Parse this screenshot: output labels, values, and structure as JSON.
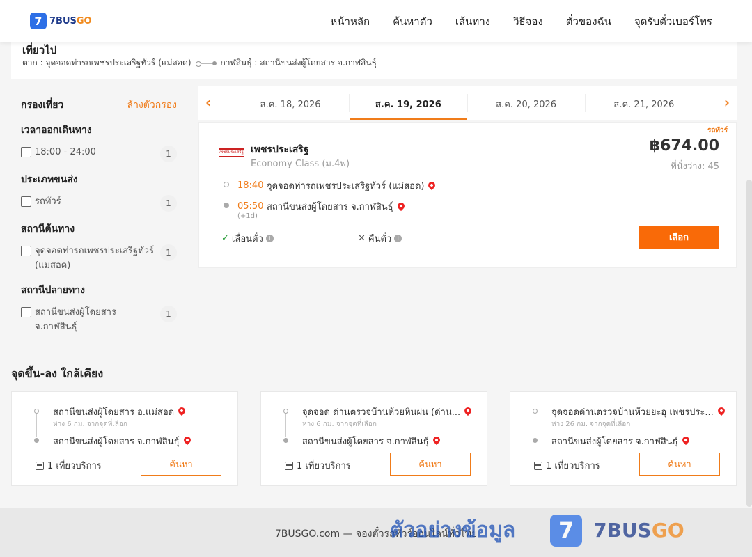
{
  "brand": {
    "logo_mark": "7",
    "name_a": "7BUS",
    "name_b": "GO"
  },
  "nav": [
    "หน้าหลัก",
    "ค้นหาตั๋ว",
    "เส้นทาง",
    "วิธีจอง",
    "ตั๋วของฉัน",
    "จุดรับตั๋วเบอร์โทร"
  ],
  "trip": {
    "title": "เที่ยวไป",
    "from": "ตาก : จุดจอดท่ารถเพชรประเสริฐทัวร์ (แม่สอด)",
    "to": "กาฬสินธุ์ : สถานีขนส่งผู้โดยสาร จ.กาฬสินธุ์"
  },
  "filters": {
    "title": "กรองเที่ยว",
    "clear": "ล้างตัวกรอง",
    "sections": [
      {
        "title": "เวลาออกเดินทาง",
        "options": [
          {
            "label": "18:00 - 24:00",
            "count": "1"
          }
        ]
      },
      {
        "title": "ประเภทขนส่ง",
        "options": [
          {
            "label": "รถทัวร์",
            "count": "1"
          }
        ]
      },
      {
        "title": "สถานีต้นทาง",
        "options": [
          {
            "label": "จุดจอดท่ารถเพชรประเสริฐทัวร์ (แม่สอด)",
            "count": "1"
          }
        ]
      },
      {
        "title": "สถานีปลายทาง",
        "options": [
          {
            "label": "สถานีขนส่งผู้โดยสาร จ.กาฬสินธุ์",
            "count": "1"
          }
        ]
      }
    ]
  },
  "dates": {
    "prev_icon": "‹",
    "next_icon": "›",
    "tabs": [
      "ส.ค. 18, 2026",
      "ส.ค. 19, 2026",
      "ส.ค. 20, 2026",
      "ส.ค. 21, 2026"
    ],
    "active_index": 1
  },
  "result": {
    "vehicle_type": "รถทัวร์",
    "operator_logo_text": "เพชรประเสริฐ",
    "operator": "เพชรประเสริฐ",
    "class": "Economy Class (ม.4พ)",
    "price": "฿674.00",
    "seats": "ที่นั่งว่าง: 45",
    "depart_time": "18:40",
    "depart_station": "จุดจอดท่ารถเพชรประเสริฐทัวร์ (แม่สอด)",
    "arrive_time": "05:50",
    "arrive_station": "สถานีขนส่งผู้โดยสาร จ.กาฬสินธุ์",
    "day_offset": "(+1d)",
    "reschedule": "เลื่อนตั๋ว",
    "refund": "คืนตั๋ว",
    "select": "เลือก"
  },
  "nearby": {
    "title": "จุดขึ้น-ลง ใกล้เคียง",
    "cards": [
      {
        "from": "สถานีขนส่งผู้โดยสาร อ.แม่สอด",
        "distance": "ห่าง 6 กม. จากจุดที่เลือก",
        "to": "สถานีขนส่งผู้โดยสาร จ.กาฬสินธุ์",
        "trips": "1 เที่ยวบริการ",
        "button": "ค้นหา"
      },
      {
        "from": "จุดจอด ด่านตรวจบ้านห้วยหินฝน (ด่าน...",
        "distance": "ห่าง 6 กม. จากจุดที่เลือก",
        "to": "สถานีขนส่งผู้โดยสาร จ.กาฬสินธุ์",
        "trips": "1 เที่ยวบริการ",
        "button": "ค้นหา"
      },
      {
        "from": "จุดจอดด่านตรวจบ้านห้วยยะอุ เพชรประ...",
        "distance": "ห่าง 26 กม. จากจุดที่เลือก",
        "to": "สถานีขนส่งผู้โดยสาร จ.กาฬสินธุ์",
        "trips": "1 เที่ยวบริการ",
        "button": "ค้นหา"
      }
    ]
  },
  "footer": {
    "text": "7BUSGO.com — จองตั๋วรถทัวร์ออนไลน์ทั่วไทย"
  },
  "watermark": {
    "text": "ตัวอย่างข้อมูล",
    "mark": "7",
    "brand_a": "7BUS",
    "brand_b": "GO"
  },
  "colors": {
    "accent": "#f96a08",
    "brand_blue": "#2d6fe6",
    "price": "#333333"
  }
}
